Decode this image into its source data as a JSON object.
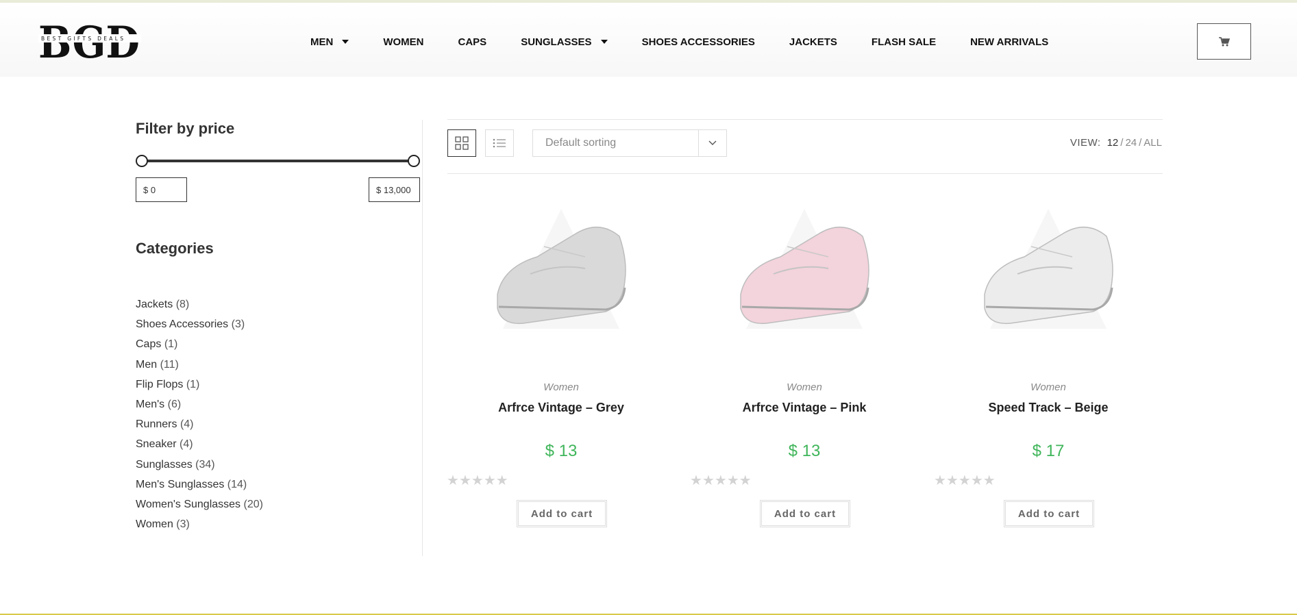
{
  "brand": {
    "logo_text": "BGD",
    "logo_subtext": "BEST GIFTS DEALS"
  },
  "nav": {
    "items": [
      {
        "label": "MEN",
        "has_dropdown": true
      },
      {
        "label": "WOMEN",
        "has_dropdown": false
      },
      {
        "label": "CAPS",
        "has_dropdown": false
      },
      {
        "label": "SUNGLASSES",
        "has_dropdown": true
      },
      {
        "label": "SHOES ACCESSORIES",
        "has_dropdown": false
      },
      {
        "label": "JACKETS",
        "has_dropdown": false
      },
      {
        "label": "FLASH SALE",
        "has_dropdown": false
      },
      {
        "label": "NEW ARRIVALS",
        "has_dropdown": false
      }
    ],
    "cart_icon": "shopping-cart-icon"
  },
  "sidebar": {
    "price_filter": {
      "title": "Filter by price",
      "min_value": "$ 0",
      "max_value": "$ 13,000"
    },
    "categories": {
      "title": "Categories",
      "items": [
        {
          "name": "Jackets",
          "count": "(8)"
        },
        {
          "name": "Shoes Accessories",
          "count": "(3)"
        },
        {
          "name": "Caps",
          "count": "(1)"
        },
        {
          "name": "Men",
          "count": "(11)"
        },
        {
          "name": "Flip Flops",
          "count": "(1)"
        },
        {
          "name": "Men's",
          "count": "(6)"
        },
        {
          "name": "Runners",
          "count": "(4)"
        },
        {
          "name": "Sneaker",
          "count": "(4)"
        },
        {
          "name": "Sunglasses",
          "count": "(34)"
        },
        {
          "name": "Men's Sunglasses",
          "count": "(14)"
        },
        {
          "name": "Women's Sunglasses",
          "count": "(20)"
        },
        {
          "name": "Women",
          "count": "(3)"
        }
      ]
    }
  },
  "toolbar": {
    "grid_icon": "grid-view-icon",
    "list_icon": "list-view-icon",
    "sort_label": "Default sorting",
    "view_label": "VIEW:",
    "view_options": [
      "12",
      "24",
      "ALL"
    ],
    "view_active": "12"
  },
  "products": [
    {
      "category": "Women",
      "title": "Arfrce Vintage – Grey",
      "price": "$ 13",
      "rating": 0,
      "button": "Add to cart",
      "color": "#d9d9d9"
    },
    {
      "category": "Women",
      "title": "Arfrce Vintage – Pink",
      "price": "$ 13",
      "rating": 0,
      "button": "Add to cart",
      "color": "#f3d3dc"
    },
    {
      "category": "Women",
      "title": "Speed Track – Beige",
      "price": "$ 17",
      "rating": 0,
      "button": "Add to cart",
      "color": "#ececec"
    }
  ],
  "colors": {
    "price": "#3fb55a",
    "accent_line": "#d8c94a"
  }
}
